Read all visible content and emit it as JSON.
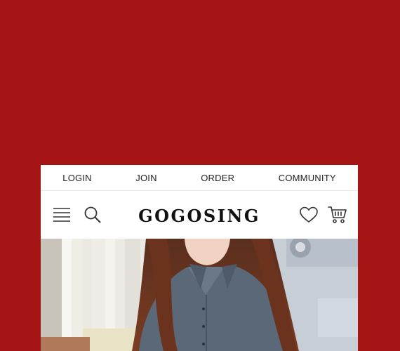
{
  "nav": {
    "links": [
      {
        "label": "LOGIN"
      },
      {
        "label": "JOIN"
      },
      {
        "label": "ORDER"
      },
      {
        "label": "COMMUNITY"
      }
    ]
  },
  "header": {
    "logo_text": "GOGOSING",
    "icons": [
      "menu-icon",
      "search-icon",
      "heart-icon",
      "cart-icon"
    ]
  },
  "colors": {
    "background": "#a51515",
    "surface": "#ffffff",
    "text": "#222222"
  }
}
